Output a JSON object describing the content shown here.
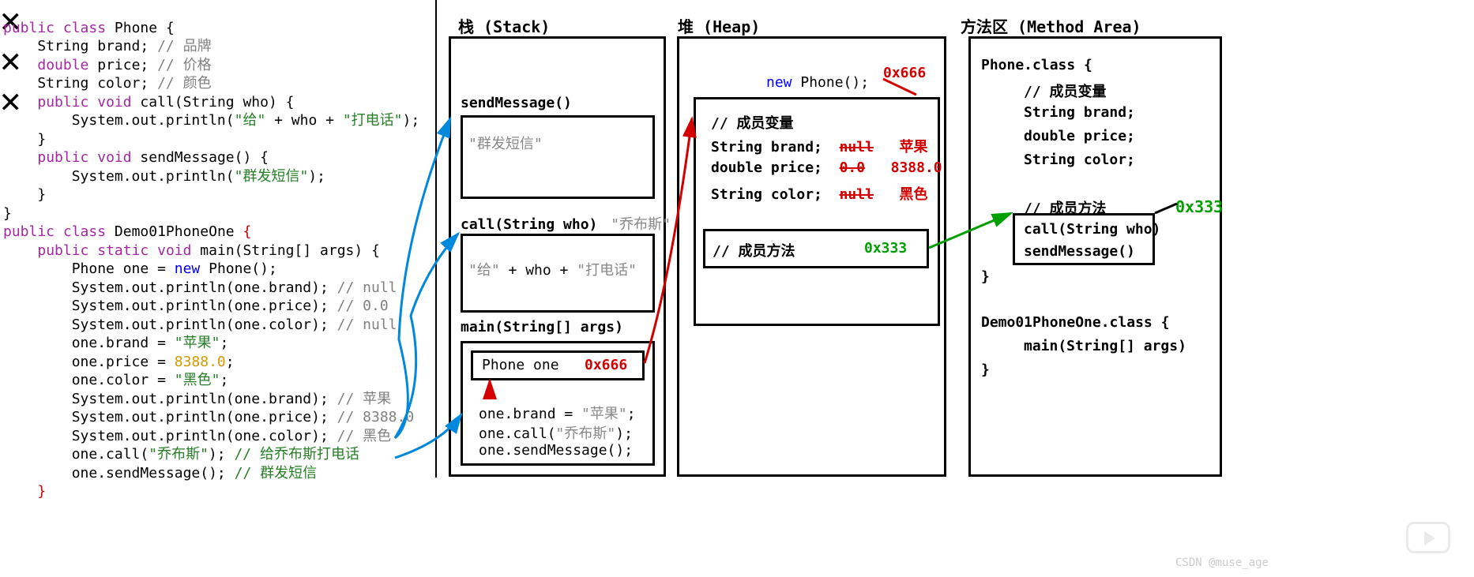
{
  "code": {
    "class1_decl": "public class Phone {",
    "f_brand": "    String brand; // 品牌",
    "f_price": "    double price; // 价格",
    "f_color": "    String color; // 颜色",
    "m_call_decl": "    public void call(String who) {",
    "m_call_body": "        System.out.println(\"给\" + who + \"打电话\");",
    "m_close1": "    }",
    "m_send_decl": "    public void sendMessage() {",
    "m_send_body": "        System.out.println(\"群发短信\");",
    "m_close2": "    }",
    "class1_close": "}",
    "class2_decl": "public class Demo01PhoneOne {",
    "main_decl": "    public static void main(String[] args) {",
    "l_new": "        Phone one = new Phone();",
    "l_p1": "        System.out.println(one.brand); // null",
    "l_p2": "        System.out.println(one.price); // 0.0",
    "l_p3": "        System.out.println(one.color); // null",
    "l_a1": "        one.brand = \"苹果\";",
    "l_a2": "        one.price = 8388.0;",
    "l_a3": "        one.color = \"黑色\";",
    "l_p4": "        System.out.println(one.brand); // 苹果",
    "l_p5": "        System.out.println(one.price); // 8388.0",
    "l_p6": "        System.out.println(one.color); // 黑色",
    "l_c1": "        one.call(\"乔布斯\"); // 给乔布斯打电话",
    "l_c2": "        one.sendMessage(); // 群发短信",
    "main_close": "    }",
    "class2_close": "}"
  },
  "stack": {
    "title": "栈 (Stack)",
    "frame_send": {
      "label": "sendMessage()",
      "content": "\"群发短信\""
    },
    "frame_call": {
      "label": "call(String who)",
      "arg": "\"乔布斯\"",
      "content": "\"给\" + who + \"打电话\""
    },
    "frame_main": {
      "label": "main(String[] args)",
      "var_decl": "Phone one",
      "var_addr": "0x666",
      "l1": "one.brand = \"苹果\";",
      "l2": "one.call(\"乔布斯\");",
      "l3": "one.sendMessage();"
    }
  },
  "heap": {
    "title": "堆 (Heap)",
    "new_expr": "new Phone();",
    "addr": "0x666",
    "fields_title": "// 成员变量",
    "f1": {
      "decl": "String brand;",
      "old": "null",
      "new": "苹果"
    },
    "f2": {
      "decl": "double price;",
      "old": "0.0",
      "new": "8388.0"
    },
    "f3": {
      "decl": "String color;",
      "old": "null",
      "new": "黑色"
    },
    "methods_title": "// 成员方法",
    "methods_addr": "0x333"
  },
  "method_area": {
    "title": "方法区 (Method Area)",
    "c1": "Phone.class {",
    "c1_fields": "// 成员变量",
    "c1_f1": "String brand;",
    "c1_f2": "double price;",
    "c1_f3": "String color;",
    "c1_methods": "// 成员方法",
    "c1_m1": "call(String who)",
    "c1_m2": "sendMessage()",
    "c1_close": "}",
    "addr": "0x333",
    "c2": "Demo01PhoneOne.class {",
    "c2_m": "main(String[] args)",
    "c2_close": "}"
  },
  "watermark": "CSDN @muse_age"
}
